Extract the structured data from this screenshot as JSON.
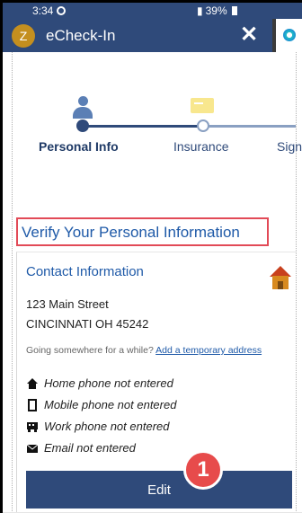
{
  "status_bar": {
    "time": "3:34",
    "battery": "39%"
  },
  "app_bar": {
    "avatar_letter": "Z",
    "title": "eCheck-In",
    "close_label": "✕"
  },
  "stepper": {
    "steps": [
      {
        "label": "Personal Info",
        "state": "active",
        "icon": "person-icon"
      },
      {
        "label": "Insurance",
        "state": "upcoming",
        "icon": "insurance-card-icon"
      },
      {
        "label": "Sign",
        "state": "upcoming",
        "icon": ""
      }
    ]
  },
  "page": {
    "heading": "Verify Your Personal Information"
  },
  "contact": {
    "title": "Contact Information",
    "address_line1": "123 Main Street",
    "address_line2": "CINCINNATI OH 45242",
    "temp_prompt": "Going somewhere for a while?",
    "temp_link": "Add a temporary address",
    "rows": [
      {
        "icon": "home-phone-icon",
        "text": "Home phone not entered"
      },
      {
        "icon": "mobile-phone-icon",
        "text": "Mobile phone not entered"
      },
      {
        "icon": "work-phone-icon",
        "text": "Work phone not entered"
      },
      {
        "icon": "email-icon",
        "text": "Email not entered"
      }
    ],
    "edit_label": "Edit"
  },
  "annotation": {
    "badge": "1"
  },
  "colors": {
    "primary": "#2f4a7a",
    "link": "#1f5aa8",
    "highlight_border": "#e24a57",
    "badge": "#e74b4b"
  }
}
